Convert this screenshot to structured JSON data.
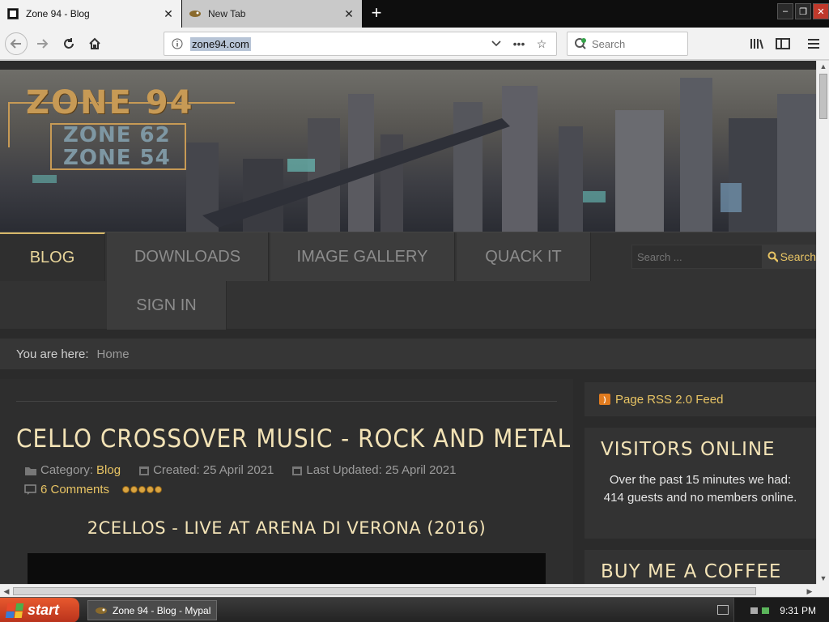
{
  "browser": {
    "tabs": [
      {
        "title": "Zone 94 - Blog",
        "active": true
      },
      {
        "title": "New Tab",
        "active": false
      }
    ],
    "url": "zone94.com",
    "search_placeholder": "Search"
  },
  "site": {
    "logo": {
      "main": "ZONE 94",
      "sub1": "ZONE 62",
      "sub2": "ZONE 54"
    },
    "menu": [
      "BLOG",
      "DOWNLOADS",
      "IMAGE GALLERY",
      "QUACK IT",
      "SIGN IN"
    ],
    "search": {
      "placeholder": "Search ...",
      "button": "Search"
    },
    "breadcrumb": {
      "label": "You are here:",
      "home": "Home"
    },
    "article": {
      "title": "CELLO CROSSOVER MUSIC - ROCK AND METAL",
      "category_label": "Category:",
      "category": "Blog",
      "created": "Created: 25 April 2021",
      "updated": "Last Updated: 25 April 2021",
      "comments": "6 Comments",
      "rating": 5,
      "subhead": "2CELLOS - LIVE AT ARENA DI VERONA (2016)"
    },
    "sidebar": {
      "rss": "Page RSS 2.0 Feed",
      "visitors_title": "VISITORS ONLINE",
      "visitors_text": "Over the past 15 minutes we had: 414 guests and no members online.",
      "coffee_title": "BUY ME A COFFEE"
    }
  },
  "taskbar": {
    "start": "start",
    "task": "Zone 94 - Blog - Mypal",
    "clock": "9:31 PM"
  },
  "colors": {
    "accent": "#e8c464",
    "heading": "#f3e3b6",
    "page_bg": "#2b2b2b"
  }
}
